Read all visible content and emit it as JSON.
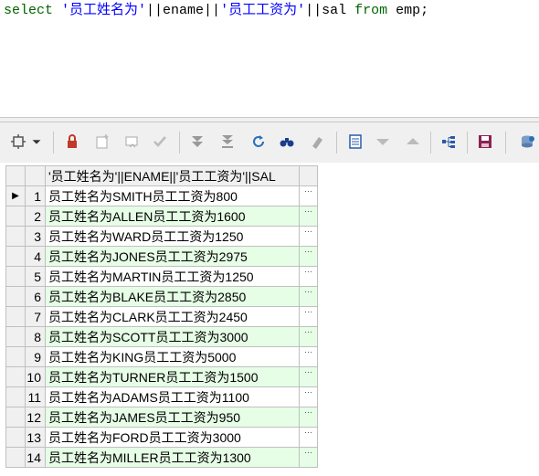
{
  "editor": {
    "sql": {
      "kw_select": "select",
      "str1": "'员工姓名为'",
      "op1": "||ename||",
      "str2": "'员工工资为'",
      "op2": "||sal",
      "kw_from": "from",
      "table": "emp;"
    }
  },
  "toolbar": {
    "buttons": [
      "grid-options-icon",
      "dropdown-arrow-icon",
      "lock-icon",
      "insert-record-icon",
      "delete-record-icon",
      "post-edit-icon",
      "fetch-next-icon",
      "fetch-last-icon",
      "refresh-icon",
      "find-icon",
      "clear-icon",
      "record-view-icon",
      "filter-down-icon",
      "filter-up-icon",
      "query-tree-icon",
      "save-icon",
      "export-icon"
    ]
  },
  "grid": {
    "column_header": "'员工姓名为'||ENAME||'员工工资为'||SAL",
    "current_row_marker": "▶",
    "cell_button": "···",
    "rows": [
      {
        "num": "1",
        "value": "员工姓名为SMITH员工工资为800"
      },
      {
        "num": "2",
        "value": "员工姓名为ALLEN员工工资为1600"
      },
      {
        "num": "3",
        "value": "员工姓名为WARD员工工资为1250"
      },
      {
        "num": "4",
        "value": "员工姓名为JONES员工工资为2975"
      },
      {
        "num": "5",
        "value": "员工姓名为MARTIN员工工资为1250"
      },
      {
        "num": "6",
        "value": "员工姓名为BLAKE员工工资为2850"
      },
      {
        "num": "7",
        "value": "员工姓名为CLARK员工工资为2450"
      },
      {
        "num": "8",
        "value": "员工姓名为SCOTT员工工资为3000"
      },
      {
        "num": "9",
        "value": "员工姓名为KING员工工资为5000"
      },
      {
        "num": "10",
        "value": "员工姓名为TURNER员工工资为1500"
      },
      {
        "num": "11",
        "value": "员工姓名为ADAMS员工工资为1100"
      },
      {
        "num": "12",
        "value": "员工姓名为JAMES员工工资为950"
      },
      {
        "num": "13",
        "value": "员工姓名为FORD员工工资为3000"
      },
      {
        "num": "14",
        "value": "员工姓名为MILLER员工工资为1300"
      }
    ]
  }
}
